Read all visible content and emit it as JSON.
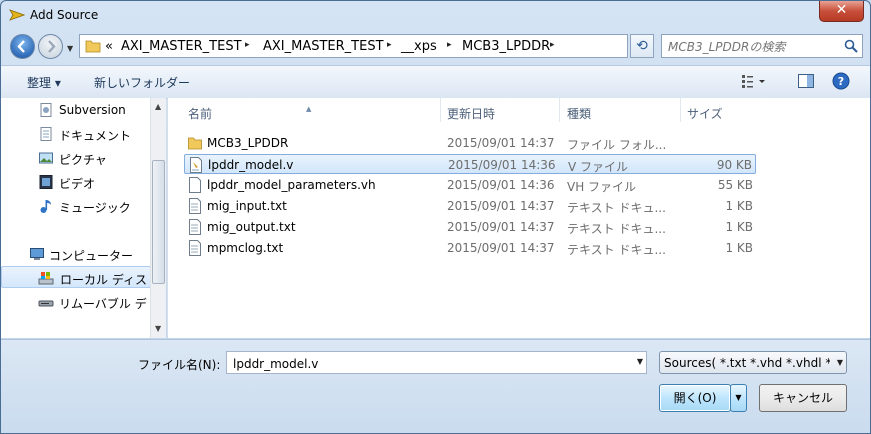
{
  "window": {
    "title": "Add Source",
    "close_label": "✕"
  },
  "address": {
    "overflow": "«",
    "crumbs": [
      "AXI_MASTER_TEST",
      "AXI_MASTER_TEST",
      "__xps",
      "MCB3_LPDDR"
    ],
    "separator": "▸"
  },
  "search": {
    "placeholder": "MCB3_LPDDRの検索"
  },
  "toolbar": {
    "organize": "整理 ▾",
    "new_folder": "新しいフォルダー"
  },
  "nav": {
    "items": [
      {
        "label": "Subversion",
        "icon": "subversion-icon"
      },
      {
        "label": "ドキュメント",
        "icon": "documents-icon"
      },
      {
        "label": "ピクチャ",
        "icon": "pictures-icon"
      },
      {
        "label": "ビデオ",
        "icon": "video-icon"
      },
      {
        "label": "ミュージック",
        "icon": "music-icon"
      },
      {
        "label": "コンピューター",
        "icon": "computer-icon"
      },
      {
        "label": "ローカル ディス",
        "icon": "local-disk-icon"
      },
      {
        "label": "リムーバブル デ",
        "icon": "removable-disk-icon"
      }
    ]
  },
  "columns": {
    "name": "名前",
    "date": "更新日時",
    "type": "種類",
    "size": "サイズ"
  },
  "files": [
    {
      "name": "MCB3_LPDDR",
      "date": "2015/09/01 14:37",
      "type": "ファイル フォル...",
      "size": "",
      "icon": "folder-icon",
      "selected": false
    },
    {
      "name": "lpddr_model.v",
      "date": "2015/09/01 14:36",
      "type": "V ファイル",
      "size": "90 KB",
      "icon": "v-file-icon",
      "selected": true
    },
    {
      "name": "lpddr_model_parameters.vh",
      "date": "2015/09/01 14:36",
      "type": "VH ファイル",
      "size": "55 KB",
      "icon": "file-icon",
      "selected": false
    },
    {
      "name": "mig_input.txt",
      "date": "2015/09/01 14:37",
      "type": "テキスト ドキュ...",
      "size": "1 KB",
      "icon": "text-file-icon",
      "selected": false
    },
    {
      "name": "mig_output.txt",
      "date": "2015/09/01 14:37",
      "type": "テキスト ドキュ...",
      "size": "1 KB",
      "icon": "text-file-icon",
      "selected": false
    },
    {
      "name": "mpmclog.txt",
      "date": "2015/09/01 14:37",
      "type": "テキスト ドキュ...",
      "size": "1 KB",
      "icon": "text-file-icon",
      "selected": false
    }
  ],
  "footer": {
    "filename_label": "ファイル名(N):",
    "filename_value": "lpddr_model.v",
    "filter_value": "Sources( *.txt *.vhd *.vhdl *.v",
    "open_label": "開く(O)",
    "cancel_label": "キャンセル"
  }
}
